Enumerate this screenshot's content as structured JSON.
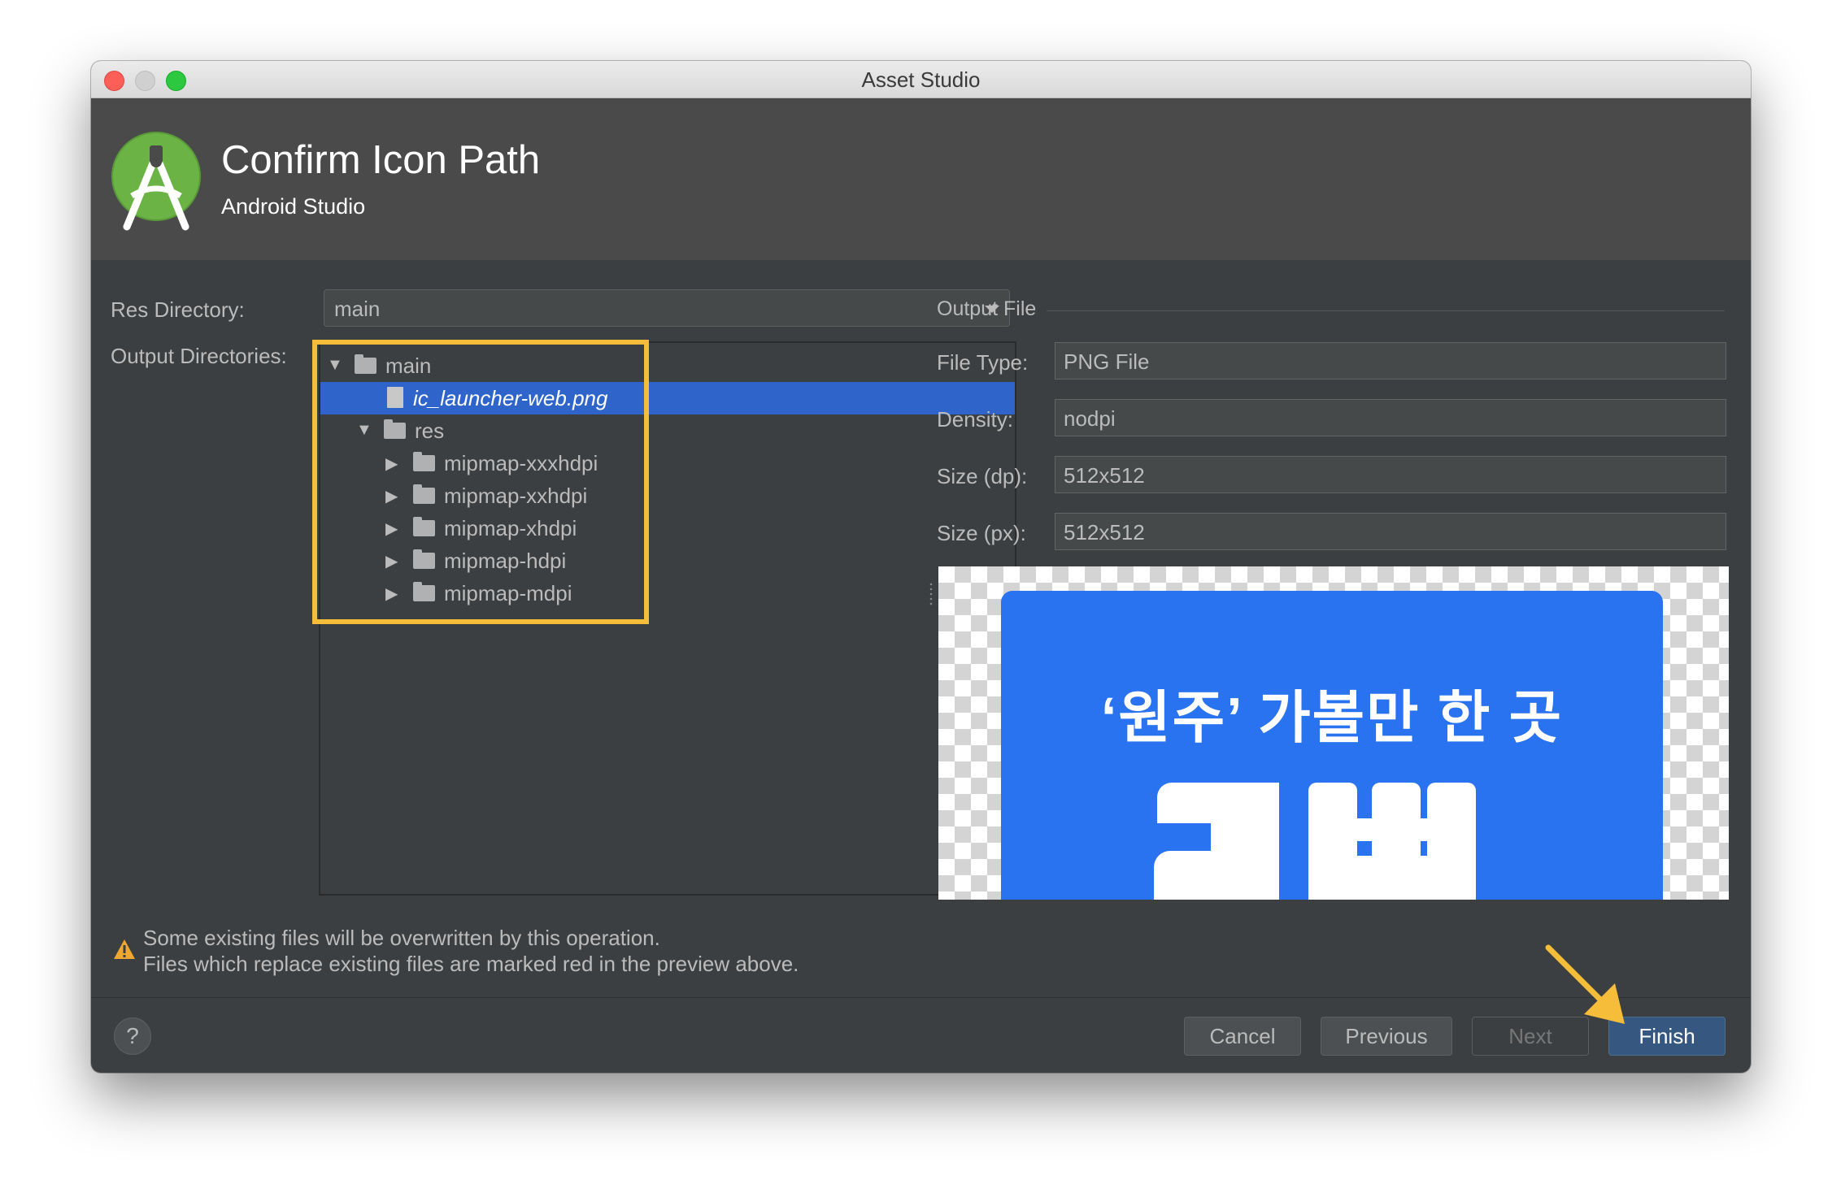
{
  "window": {
    "title": "Asset Studio"
  },
  "header": {
    "title": "Confirm Icon Path",
    "subtitle": "Android Studio"
  },
  "form": {
    "res_directory_label": "Res Directory:",
    "res_directory_value": "main",
    "output_directories_label": "Output Directories:"
  },
  "tree": {
    "items": [
      {
        "label": "main",
        "expanded": true,
        "type": "folder"
      },
      {
        "label": "ic_launcher-web.png",
        "type": "file",
        "selected": true
      },
      {
        "label": "res",
        "expanded": true,
        "type": "folder"
      },
      {
        "label": "mipmap-xxxhdpi",
        "expanded": false,
        "type": "folder"
      },
      {
        "label": "mipmap-xxhdpi",
        "expanded": false,
        "type": "folder"
      },
      {
        "label": "mipmap-xhdpi",
        "expanded": false,
        "type": "folder"
      },
      {
        "label": "mipmap-hdpi",
        "expanded": false,
        "type": "folder"
      },
      {
        "label": "mipmap-mdpi",
        "expanded": false,
        "type": "folder"
      }
    ]
  },
  "output_file": {
    "section_label": "Output File",
    "file_type_label": "File Type:",
    "file_type_value": "PNG File",
    "density_label": "Density:",
    "density_value": "nodpi",
    "size_dp_label": "Size (dp):",
    "size_dp_value": "512x512",
    "size_px_label": "Size (px):",
    "size_px_value": "512x512"
  },
  "preview": {
    "text": "‘원주’ 가볼만 한 곳"
  },
  "warning": {
    "line1": "Some existing files will be overwritten by this operation.",
    "line2": "Files which replace existing files are marked red in the preview above."
  },
  "footer": {
    "help": "?",
    "cancel": "Cancel",
    "previous": "Previous",
    "next": "Next",
    "finish": "Finish"
  },
  "colors": {
    "dialog_bg": "#3c3f41",
    "header_bg": "#4a4a4a",
    "selection": "#2f65ca",
    "annotation": "#f6bd3a",
    "primary_button": "#365880",
    "preview_icon": "#2a73f0"
  }
}
